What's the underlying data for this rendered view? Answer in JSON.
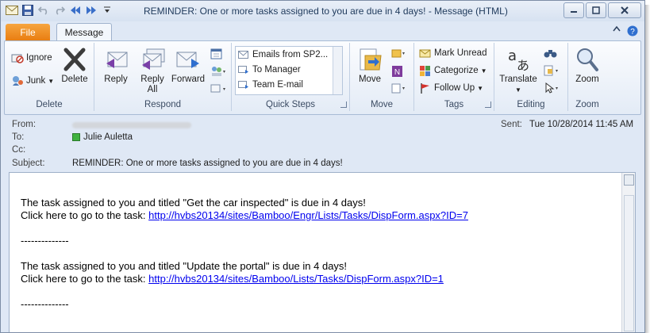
{
  "window": {
    "title": "REMINDER: One or more tasks assigned to you are due in 4 days!  -  Message (HTML)"
  },
  "tabs": {
    "file": "File",
    "message": "Message"
  },
  "ribbon": {
    "delete_group": {
      "label": "Delete",
      "ignore": "Ignore",
      "junk": "Junk",
      "delete": "Delete"
    },
    "respond_group": {
      "label": "Respond",
      "reply": "Reply",
      "reply_all_1": "Reply",
      "reply_all_2": "All",
      "forward": "Forward"
    },
    "quick_steps_group": {
      "label": "Quick Steps",
      "items": [
        "Emails from SP2...",
        "To Manager",
        "Team E-mail"
      ]
    },
    "move_group": {
      "label": "Move",
      "move": "Move"
    },
    "tags_group": {
      "label": "Tags",
      "mark_unread": "Mark Unread",
      "categorize": "Categorize",
      "follow_up": "Follow Up"
    },
    "editing_group": {
      "label": "Editing",
      "translate": "Translate"
    },
    "zoom_group": {
      "label": "Zoom",
      "zoom": "Zoom"
    }
  },
  "header": {
    "from_label": "From:",
    "to_label": "To:",
    "to_value": "Julie Auletta",
    "cc_label": "Cc:",
    "subject_label": "Subject:",
    "subject_value": "REMINDER: One or more tasks assigned to you are due in 4 days!",
    "sent_label": "Sent:",
    "sent_value": "Tue 10/28/2014 11:45 AM"
  },
  "body": {
    "task1_line": "The task assigned to you and titled \"Get the car inspected\" is due in 4 days!",
    "task1_click": "Click here to go to the task: ",
    "task1_link": "http://hvbs20134/sites/Bamboo/Engr/Lists/Tasks/DispForm.aspx?ID=7",
    "separator1": "--------------",
    "task2_line": "The task assigned to you and titled \"Update the portal\" is due in 4 days!",
    "task2_click": "Click here to go to the task: ",
    "task2_link": "http://hvbs20134/sites/Bamboo/Lists/Tasks/DispForm.aspx?ID=1",
    "separator2": "--------------"
  },
  "colors": {
    "file_tab": "#e97e12",
    "link": "#0000ee",
    "ribbon_bg": "#e3ebf6"
  }
}
